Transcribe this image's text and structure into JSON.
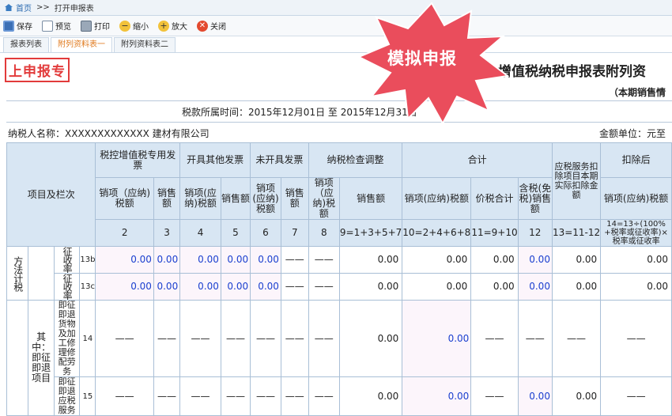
{
  "breadcrumb": {
    "home": "首页",
    "separator": ">>",
    "current": "打开申报表"
  },
  "toolbar": {
    "save": "保存",
    "preview": "预览",
    "print": "打印",
    "zoom_out": "缩小",
    "zoom_in": "放大",
    "close": "关闭"
  },
  "tabs": [
    "报表列表",
    "附列资料表一",
    "附列资料表二"
  ],
  "stamp": "上申报专",
  "badge": "模拟申报",
  "title": "增值税纳税申报表附列资",
  "subtitle": "（本期销售情",
  "period": "税款所属时间：2015年12月01日 至 2015年12月31日",
  "taxpayer": "纳税人名称：XXXXXXXXXXXXX 建材有限公司",
  "unit": "金额单位：元至",
  "headers": {
    "item": "项目及栏次",
    "g1": "税控增值税专用发票",
    "g2": "开具其他发票",
    "g3": "未开具发票",
    "g4": "纳税检查调整",
    "g5": "合计",
    "g6": "应税服务扣除项目本期实际扣除金额",
    "g7": "扣除后",
    "sales": "销售额",
    "tax": "销项(应纳)税额",
    "g1_tax": "销项（应纳)税额",
    "g4_tax": "销项（应纳)税额",
    "g5_tax": "销项(应纳)税额",
    "total": "价税合计",
    "incl": "含税(免税)销售额",
    "g7_tax": "销项(应纳)税额"
  },
  "col_nums": [
    "2",
    "3",
    "4",
    "5",
    "6",
    "7",
    "8",
    "9=1+3+5+7",
    "10=2+4+6+8",
    "11=9+10",
    "12",
    "13=11-12",
    "14=13÷(100%+税率或征收率)×税率或征收率"
  ],
  "rows": {
    "left_group": "方法计税",
    "sub_group_a": "征收率",
    "sub_group_a2": "征收率",
    "sub_group_b": "其中：即征即退项目",
    "r13b_label": "13b",
    "r13c_label": "13c",
    "r14_label": "14",
    "r15_label": "15",
    "r14_name": "即征即退货物及加工修理修配劳务",
    "r15_name": "即征即退应税服务",
    "zero": "0.00",
    "dash": "——"
  }
}
